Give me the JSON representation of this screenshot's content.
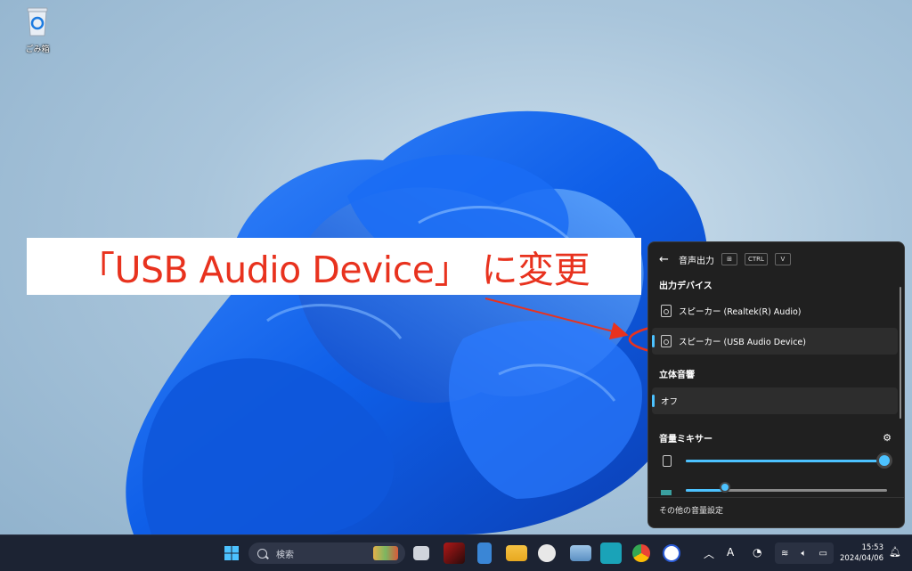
{
  "desktop": {
    "recycle_bin_label": "ごみ箱"
  },
  "annotation": {
    "text": "「USB Audio Device」 に変更",
    "color": "#e8321e"
  },
  "flyout": {
    "title": "音声出力",
    "shortcut_keys": [
      "⊞",
      "CTRL",
      "V"
    ],
    "output_section": "出力デバイス",
    "devices": [
      {
        "label": "スピーカー (Realtek(R) Audio)",
        "selected": false
      },
      {
        "label": "スピーカー (USB Audio Device)",
        "selected": true
      }
    ],
    "spatial_section": "立体音響",
    "spatial_value": "オフ",
    "mixer_section": "音量ミキサー",
    "mixer": [
      {
        "icon": "speaker-icon",
        "level": 1.0
      },
      {
        "icon": "app-icon",
        "level": 0.2
      }
    ],
    "footer": "その他の音量設定",
    "accent": "#4cc2ff"
  },
  "taskbar": {
    "search_placeholder": "検索",
    "ime": "A",
    "time": "15:53",
    "date": "2024/04/06"
  }
}
